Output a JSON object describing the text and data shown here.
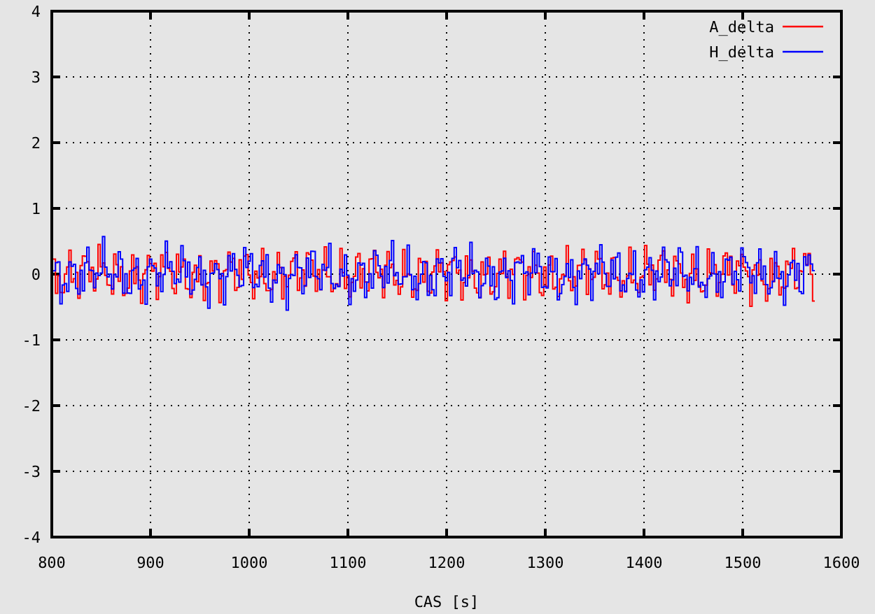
{
  "plot": {
    "y_ticks": [
      "4",
      "3",
      "2",
      "1",
      "0",
      "-1",
      "-2",
      "-3",
      "-4"
    ],
    "x_ticks": [
      "800",
      "900",
      "1000",
      "1100",
      "1200",
      "1300",
      "1400",
      "1500",
      "1600"
    ],
    "x_label": "CAS [s]",
    "legend": [
      {
        "label": "A_delta",
        "color": "#ff0000"
      },
      {
        "label": "H_delta",
        "color": "#0000ff"
      }
    ]
  }
}
